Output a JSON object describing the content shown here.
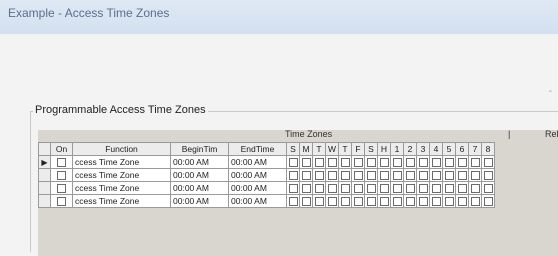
{
  "window": {
    "title": "Example - Access Time Zones"
  },
  "hint_mark": "-",
  "group": {
    "title": "Programmable Access Time Zones"
  },
  "grid": {
    "super_header": {
      "time_zones": "Time Zones",
      "separator": "|",
      "rel": "Rela"
    },
    "columns": {
      "on": "On",
      "function": "Function",
      "begin": "BeginTim",
      "end": "EndTime",
      "days": [
        "S",
        "M",
        "T",
        "W",
        "T",
        "F",
        "S",
        "H",
        "1",
        "2",
        "3",
        "4",
        "5",
        "6",
        "7",
        "8"
      ]
    },
    "rows": [
      {
        "indicator": "▶",
        "function": "ccess Time Zone",
        "begin": "00:00 AM",
        "end": "00:00 AM"
      },
      {
        "indicator": "",
        "function": "ccess Time Zone",
        "begin": "00:00 AM",
        "end": "00:00 AM"
      },
      {
        "indicator": "",
        "function": "ccess Time Zone",
        "begin": "00:00 AM",
        "end": "00:00 AM"
      },
      {
        "indicator": "",
        "function": "ccess Time Zone",
        "begin": "00:00 AM",
        "end": "00:00 AM"
      }
    ]
  }
}
